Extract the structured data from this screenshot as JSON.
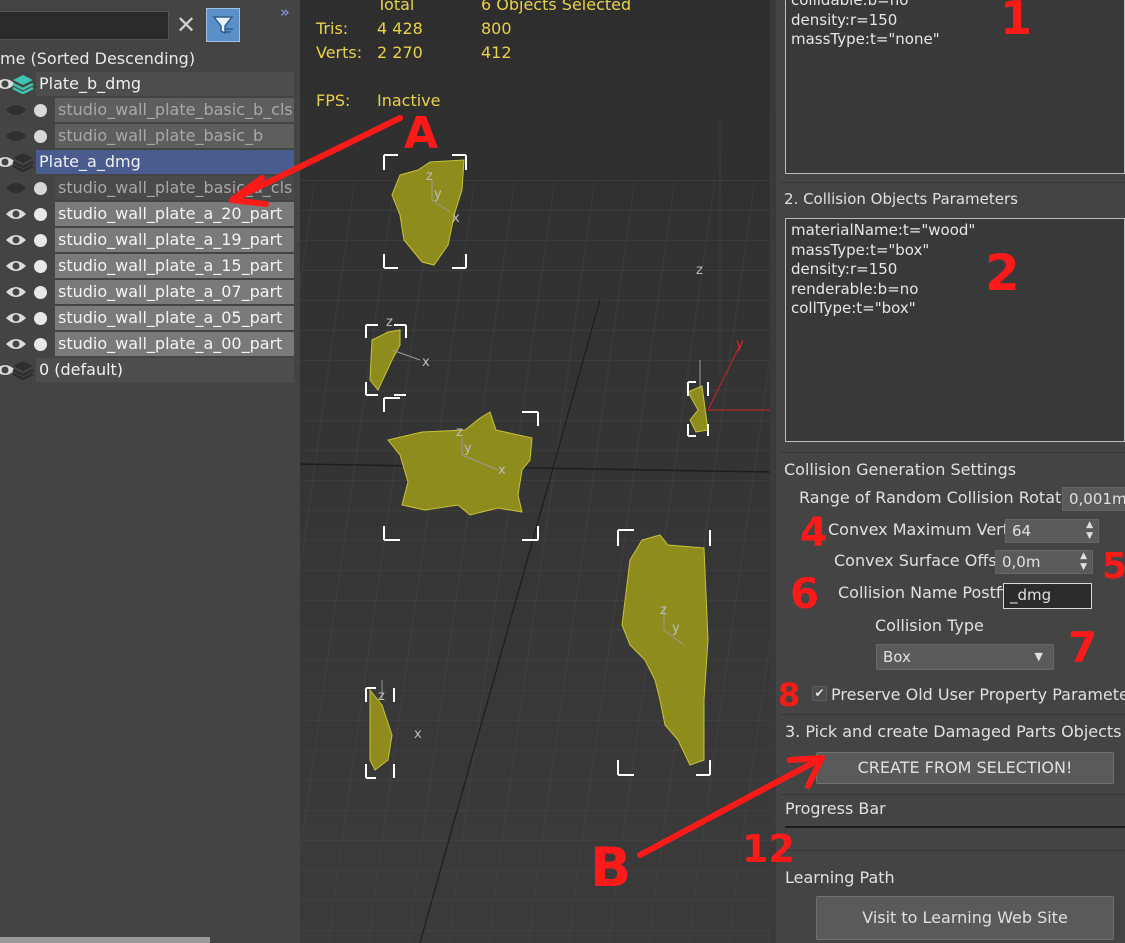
{
  "explorer": {
    "column_header": "me (Sorted Descending)",
    "rows": [
      {
        "label": "Plate_b_dmg"
      },
      {
        "label": "studio_wall_plate_basic_b_cls"
      },
      {
        "label": "studio_wall_plate_basic_b"
      },
      {
        "label": "Plate_a_dmg"
      },
      {
        "label": "studio_wall_plate_basic_a_cls"
      },
      {
        "label": "studio_wall_plate_a_20_part"
      },
      {
        "label": "studio_wall_plate_a_19_part"
      },
      {
        "label": "studio_wall_plate_a_15_part"
      },
      {
        "label": "studio_wall_plate_a_07_part"
      },
      {
        "label": "studio_wall_plate_a_05_part"
      },
      {
        "label": "studio_wall_plate_a_00_part"
      },
      {
        "label": "0 (default)"
      }
    ]
  },
  "viewport": {
    "total_label": "Total",
    "selected_label": "6 Objects Selected",
    "tris_label": "Tris:",
    "tris_total": "4 428",
    "tris_selected": "800",
    "verts_label": "Verts:",
    "verts_total": "2 270",
    "verts_selected": "412",
    "fps_label": "FPS:",
    "fps_value": "Inactive",
    "axis_x": "x",
    "axis_y": "y",
    "axis_z": "z"
  },
  "panel": {
    "props1_lines": "collidable:b=no\ndensity:r=150\nmassType:t=\"none\"",
    "section2_title": "2. Collision Objects Parameters",
    "props2_lines": "materialName:t=\"wood\"\nmassType:t=\"box\"\ndensity:r=150\nrenderable:b=no\ncollType:t=\"box\"",
    "gen_title": "Collision Generation Settings",
    "range_label": "Range of Random Collision Rotation",
    "range_value": "0,001m",
    "convex_verts_label": "Convex Maximum Verts",
    "convex_verts_value": "64",
    "convex_offset_label": "Convex Surface Offset",
    "convex_offset_value": "0,0m",
    "postfix_label": "Collision Name Postfix",
    "postfix_value": "_dmg",
    "coll_type_label": "Collision Type",
    "coll_type_value": "Box",
    "preserve_label": "Preserve Old User Property Parameters",
    "section3_title": "3. Pick and create Damaged Parts Objects",
    "create_button": "CREATE FROM SELECTION!",
    "progress_label": "Progress Bar",
    "learning_label": "Learning Path",
    "visit_button": "Visit to Learning Web Site"
  },
  "annotations": {
    "a": "A",
    "b": "B",
    "n1": "1",
    "n2": "2",
    "n4": "4",
    "n5": "5",
    "n6": "6",
    "n7": "7",
    "n8": "8",
    "n12": "12",
    "color": "#ff1a1a"
  }
}
